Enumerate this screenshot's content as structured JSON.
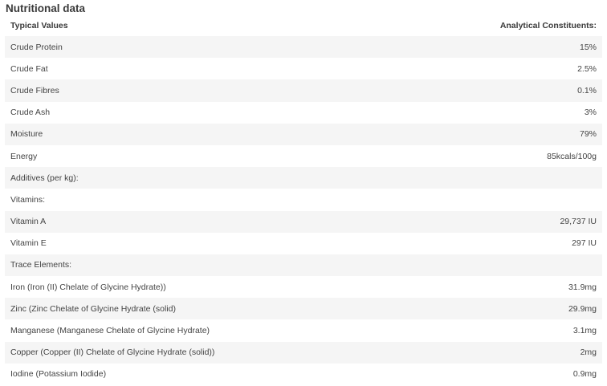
{
  "title": "Nutritional data",
  "table": {
    "headers": [
      "Typical Values",
      "Analytical Constituents:"
    ],
    "rows": [
      {
        "label": "Crude Protein",
        "value": "15%"
      },
      {
        "label": "Crude Fat",
        "value": "2.5%"
      },
      {
        "label": "Crude Fibres",
        "value": "0.1%"
      },
      {
        "label": "Crude Ash",
        "value": "3%"
      },
      {
        "label": "Moisture",
        "value": "79%"
      },
      {
        "label": "Energy",
        "value": "85kcals/100g"
      },
      {
        "label": "Additives (per kg):",
        "value": ""
      },
      {
        "label": "Vitamins:",
        "value": ""
      },
      {
        "label": "Vitamin A",
        "value": "29,737 IU"
      },
      {
        "label": "Vitamin E",
        "value": "297 IU"
      },
      {
        "label": "Trace Elements:",
        "value": ""
      },
      {
        "label": "Iron (Iron (II) Chelate of Glycine Hydrate))",
        "value": "31.9mg"
      },
      {
        "label": "Zinc (Zinc Chelate of Glycine Hydrate (solid)",
        "value": "29.9mg"
      },
      {
        "label": "Manganese (Manganese Chelate of Glycine Hydrate)",
        "value": "3.1mg"
      },
      {
        "label": "Copper (Copper (II) Chelate of Glycine Hydrate (solid))",
        "value": "2mg"
      },
      {
        "label": "Iodine (Potassium Iodide)",
        "value": "0.9mg"
      }
    ]
  }
}
